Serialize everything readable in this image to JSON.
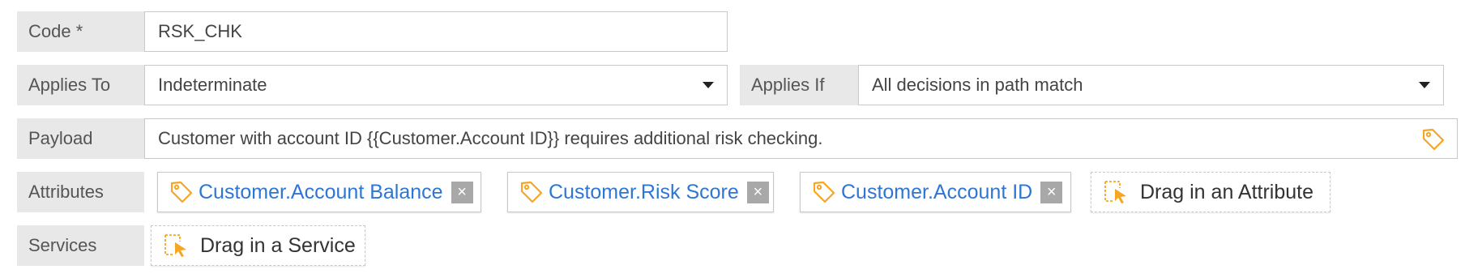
{
  "code": {
    "label": "Code *",
    "value": "RSK_CHK"
  },
  "applies_to": {
    "label": "Applies To",
    "value": "Indeterminate"
  },
  "applies_if": {
    "label": "Applies If",
    "value": "All decisions in path match"
  },
  "payload": {
    "label": "Payload",
    "value": "Customer with account ID {{Customer.Account ID}} requires additional risk checking."
  },
  "attributes": {
    "label": "Attributes",
    "items": [
      {
        "label": "Customer.Account Balance",
        "remove": "×"
      },
      {
        "label": "Customer.Risk Score",
        "remove": "×"
      },
      {
        "label": "Customer.Account ID",
        "remove": "×"
      }
    ],
    "drop_label": "Drag in an Attribute"
  },
  "services": {
    "label": "Services",
    "drop_label": "Drag in a Service"
  },
  "colors": {
    "accent": "#f5a623",
    "link": "#2f76d4",
    "label_bg": "#e8e8e8"
  }
}
